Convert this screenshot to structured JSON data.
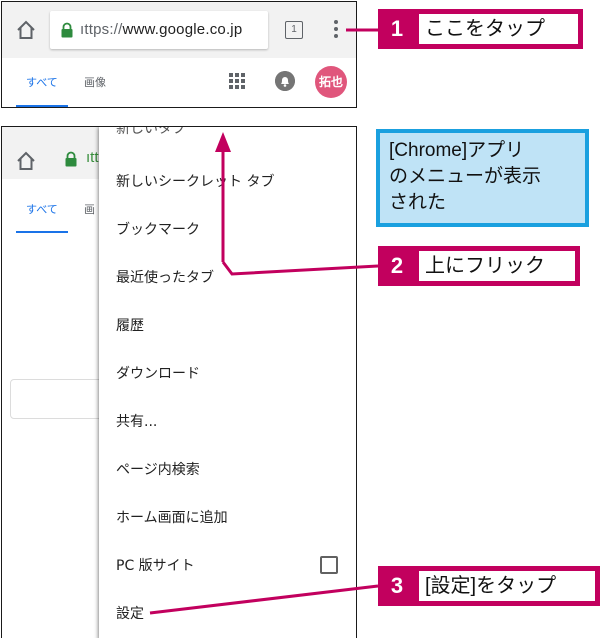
{
  "top_screen": {
    "url_scheme": "ıttps://",
    "url_host": "www.google.co.jp",
    "tab_count": "1",
    "tabs": {
      "all": "すべて",
      "images": "画像"
    },
    "avatar_text": "拓也"
  },
  "bottom_screen": {
    "url_partial": "ıtt",
    "tabs": {
      "all": "すべて",
      "images_partial": "画"
    },
    "menu_items": [
      "新しいタブ",
      "新しいシークレット タブ",
      "ブックマーク",
      "最近使ったタブ",
      "履歴",
      "ダウンロード",
      "共有...",
      "ページ内検索",
      "ホーム画面に追加",
      "PC 版サイト",
      "設定"
    ]
  },
  "annotations": {
    "step1": {
      "number": "1",
      "text": "ここをタップ"
    },
    "info": {
      "line1": "[Chrome]アプリ",
      "line2": "のメニューが表示",
      "line3": "された"
    },
    "step2": {
      "number": "2",
      "text": "上にフリック"
    },
    "step3": {
      "number": "3",
      "text": "[設定]をタップ"
    }
  },
  "colors": {
    "annotation": "#c2005e",
    "info_fill": "#bfe3f6",
    "info_border": "#1aa0df",
    "link_blue": "#1a73e8",
    "avatar": "#e0567c"
  },
  "icons": [
    "home-icon",
    "lock-icon",
    "tab-switcher-icon",
    "menu-kebab-icon",
    "apps-grid-icon",
    "notification-bell-icon"
  ]
}
